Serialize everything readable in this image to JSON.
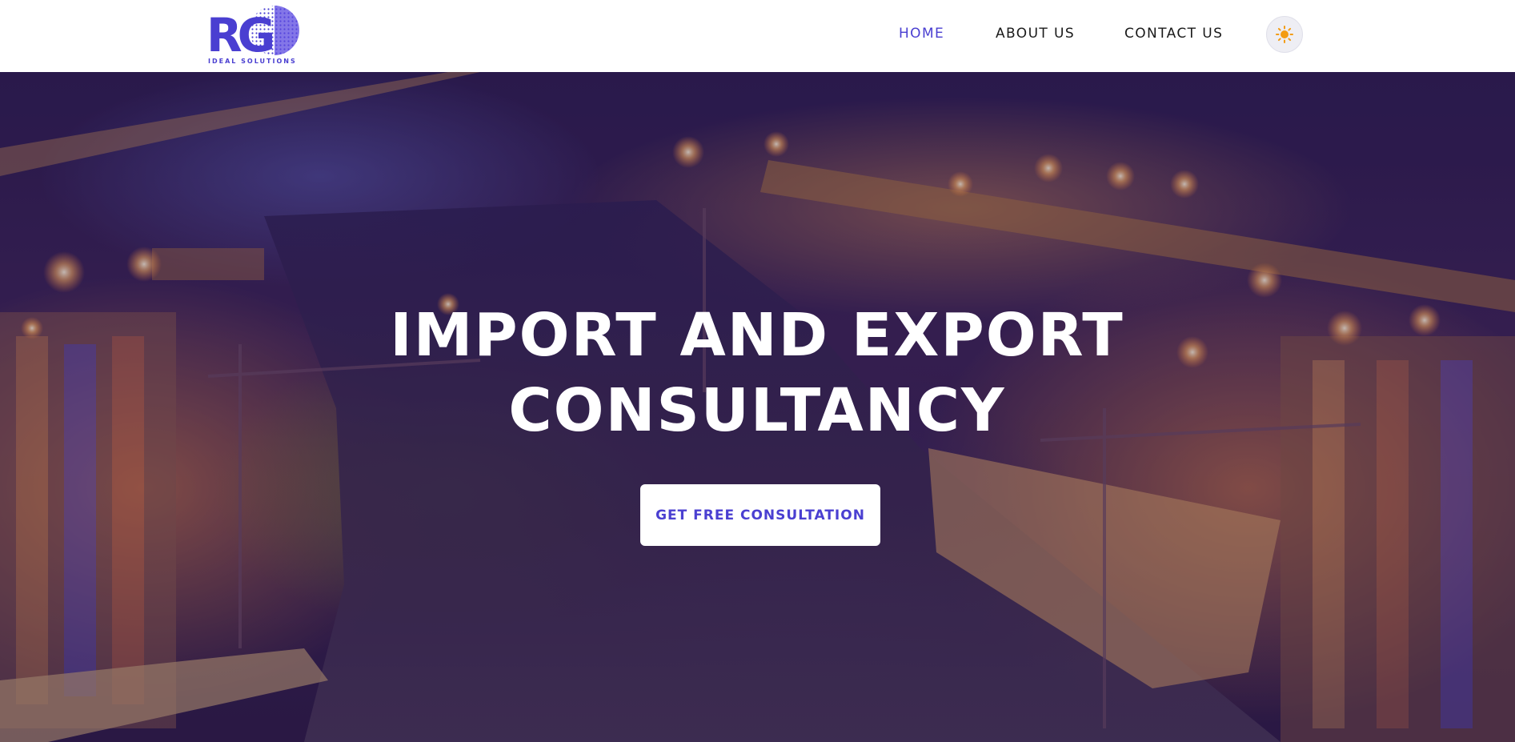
{
  "brand": {
    "logo_letters": "RG",
    "tagline": "IDEAL SOLUTIONS",
    "accent": "#4a3fd1"
  },
  "nav": {
    "items": [
      {
        "label": "HOME",
        "active": true
      },
      {
        "label": "ABOUT US",
        "active": false
      },
      {
        "label": "CONTACT US",
        "active": false
      }
    ],
    "theme_toggle_icon": "sun-icon",
    "theme_icon_color": "#f39c12"
  },
  "hero": {
    "title_line1": "IMPORT AND EXPORT",
    "title_line2": "CONSULTANCY",
    "cta_label": "GET FREE CONSULTATION",
    "background": "night-port-aerial-image"
  }
}
